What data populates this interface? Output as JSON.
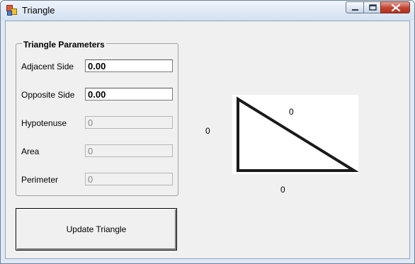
{
  "window": {
    "title": "Triangle"
  },
  "group": {
    "title": "Triangle Parameters"
  },
  "fields": {
    "adjacent": {
      "label": "Adjacent Side",
      "value": "0.00"
    },
    "opposite": {
      "label": "Opposite Side",
      "value": "0.00"
    },
    "hypotenuse": {
      "label": "Hypotenuse",
      "value": "0"
    },
    "area": {
      "label": "Area",
      "value": "0"
    },
    "perimeter": {
      "label": "Perimeter",
      "value": "0"
    }
  },
  "update_button": {
    "label": "Update Triangle"
  },
  "triangle": {
    "hypotenuse_label": "0",
    "opposite_label": "0",
    "adjacent_label": "0"
  },
  "icons": [
    "app-icon",
    "minimize-icon",
    "maximize-icon",
    "close-icon"
  ]
}
